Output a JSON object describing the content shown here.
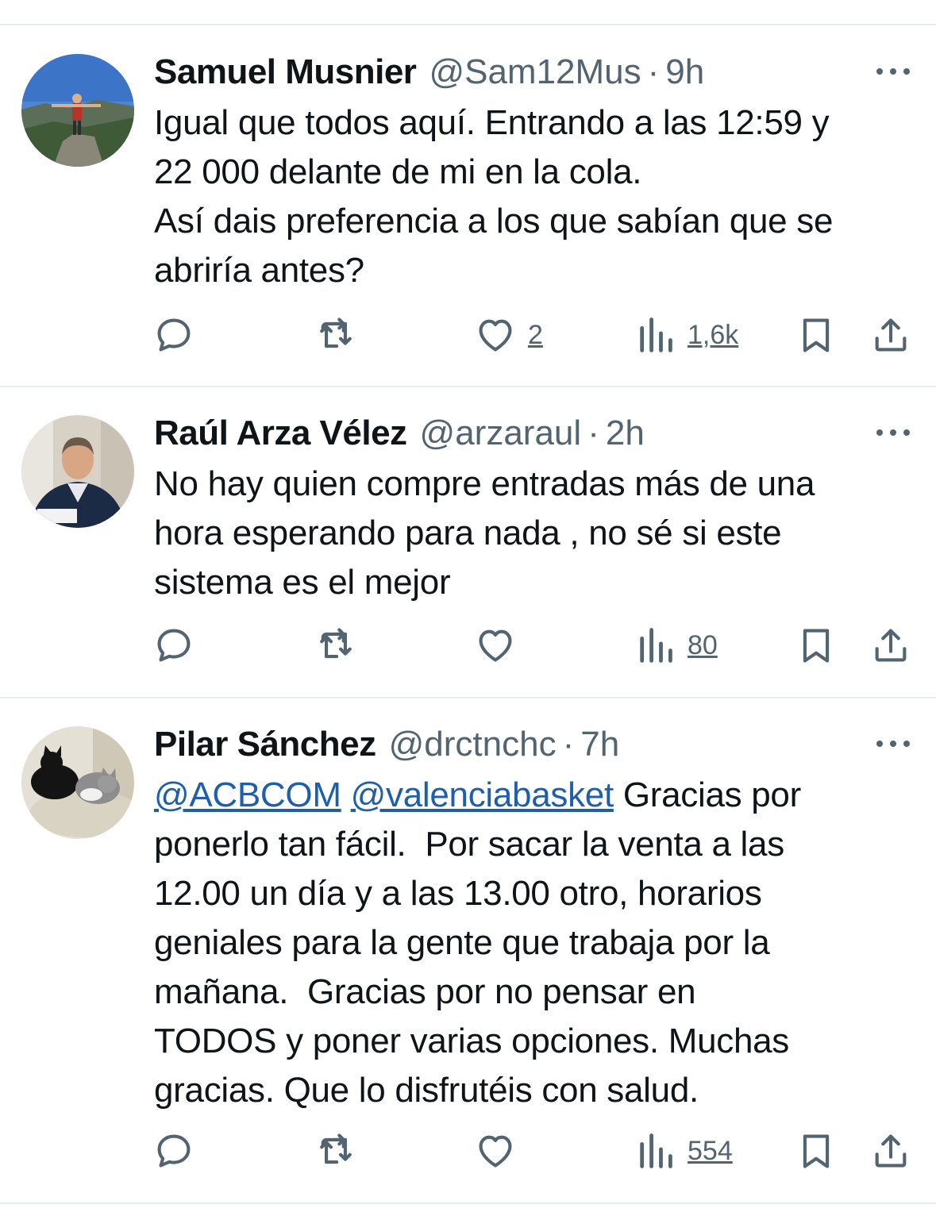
{
  "tweets": [
    {
      "name": "Samuel Musnier",
      "handle": "@Sam12Mus",
      "separator": "·",
      "time": "9h",
      "text_lines": [
        "Igual que todos aquí. Entrando a las 12:59 y",
        "22 000 delante de mi en la cola.",
        "Así dais preferencia a los que sabían que se",
        "abriría antes?"
      ],
      "likes": "2",
      "views": "1,6k"
    },
    {
      "name": "Raúl Arza Vélez",
      "handle": "@arzaraul",
      "separator": "·",
      "time": "2h",
      "text_lines": [
        "No hay quien compre entradas más de una",
        "hora esperando para nada , no sé si este",
        "sistema es el mejor"
      ],
      "likes": "",
      "views": "80"
    },
    {
      "name": "Pilar Sánchez",
      "handle": "@drctnchc",
      "separator": "·",
      "time": "7h",
      "mention_1": "@ACBCOM",
      "mention_2": "@valenciabasket",
      "first_line_rest": " Gracias por",
      "text_lines": [
        "ponerlo tan fácil.  Por sacar la venta a las",
        "12.00 un día y a las 13.00 otro, horarios",
        "geniales para la gente que trabaja por la",
        "mañana.  Gracias por no pensar en",
        "TODOS y poner varias opciones. Muchas",
        "gracias. Que lo disfrutéis con salud."
      ],
      "likes": "",
      "views": "554"
    }
  ],
  "icons": {
    "reply": "reply-icon",
    "retweet": "retweet-icon",
    "like": "heart-icon",
    "views": "views-icon",
    "bookmark": "bookmark-icon",
    "share": "share-icon",
    "more": "more-icon"
  },
  "colors": {
    "text": "#0f1419",
    "secondary": "#536471",
    "link": "#1d5fae",
    "divider": "#e6ecef"
  }
}
